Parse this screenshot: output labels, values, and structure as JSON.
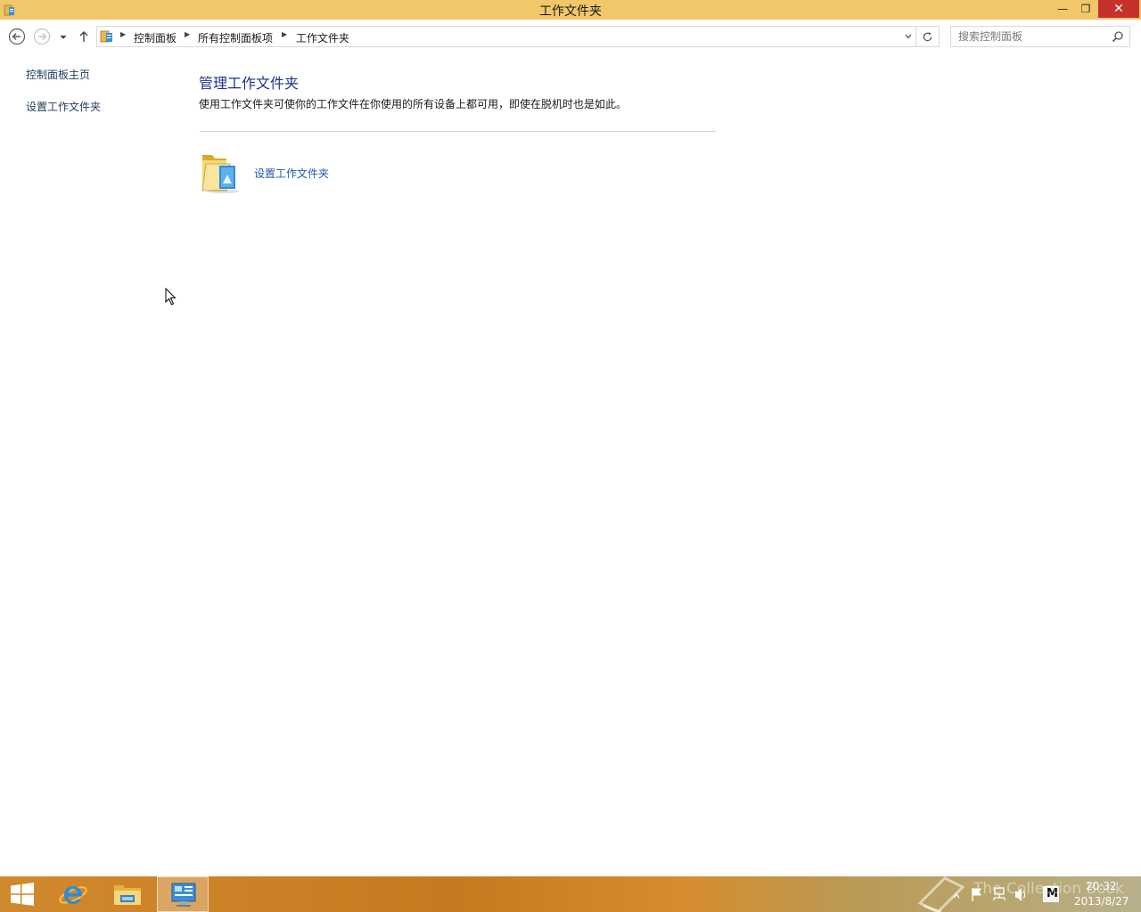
{
  "window": {
    "title": "工作文件夹",
    "minimize_glyph": "—",
    "maximize_glyph": "❐",
    "close_glyph": "✕"
  },
  "address": {
    "breadcrumbs": [
      "控制面板",
      "所有控制面板项",
      "工作文件夹"
    ],
    "search_placeholder": "搜索控制面板"
  },
  "sidebar": {
    "items": [
      {
        "label": "控制面板主页"
      },
      {
        "label": "设置工作文件夹"
      }
    ]
  },
  "main": {
    "heading": "管理工作文件夹",
    "description": "使用工作文件夹可使你的工作文件在你使用的所有设备上都可用，即使在脱机时也是如此。",
    "setup_link": "设置工作文件夹"
  },
  "taskbar": {
    "apps": [
      "start-icon",
      "internet-explorer-icon",
      "file-explorer-icon",
      "control-panel-icon"
    ],
    "clock_time": "20:32",
    "clock_date": "2013/8/27",
    "ime_label": "M",
    "watermark": "The Collection Book"
  },
  "colors": {
    "titlebar": "#f0c869",
    "close_button": "#c7312b",
    "link": "#1e5aa8",
    "heading": "#1e3287"
  }
}
